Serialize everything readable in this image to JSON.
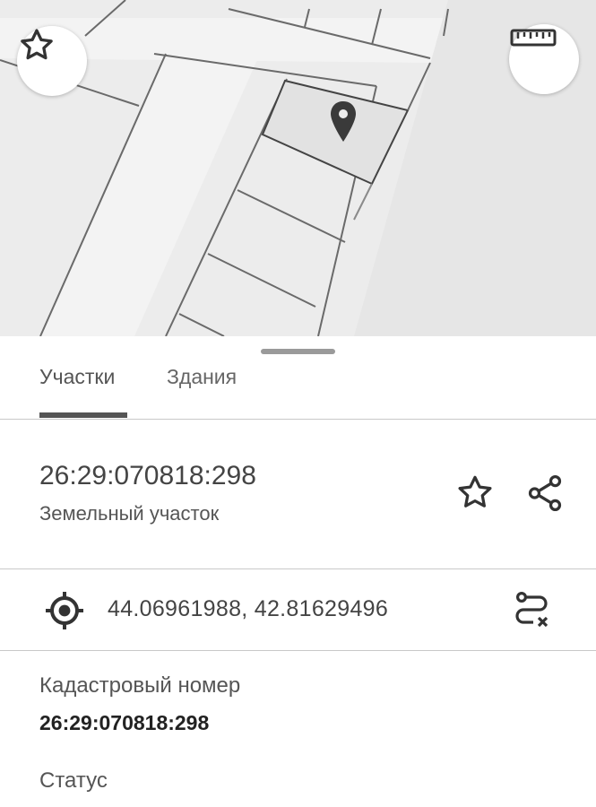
{
  "map": {
    "favorite_icon": "star-outline-icon",
    "ruler_icon": "ruler-icon",
    "marker_icon": "map-pin-icon"
  },
  "tabs": [
    {
      "label": "Участки",
      "active": true
    },
    {
      "label": "Здания",
      "active": false
    }
  ],
  "parcel": {
    "cadastral_number": "26:29:070818:298",
    "type": "Земельный участок",
    "actions": [
      "star-outline-icon",
      "share-icon"
    ]
  },
  "location": {
    "coordinates": "44.06961988, 42.81629496",
    "icon": "target-icon",
    "route_icon": "route-clear-icon"
  },
  "details": {
    "cadastral_label": "Кадастровый номер",
    "cadastral_value": "26:29:070818:298",
    "status_label": "Статус"
  },
  "colors": {
    "map_background": "#ececec",
    "parcel_stroke": "#555555",
    "tab_indicator": "#555555",
    "divider": "#c9c9c9"
  }
}
